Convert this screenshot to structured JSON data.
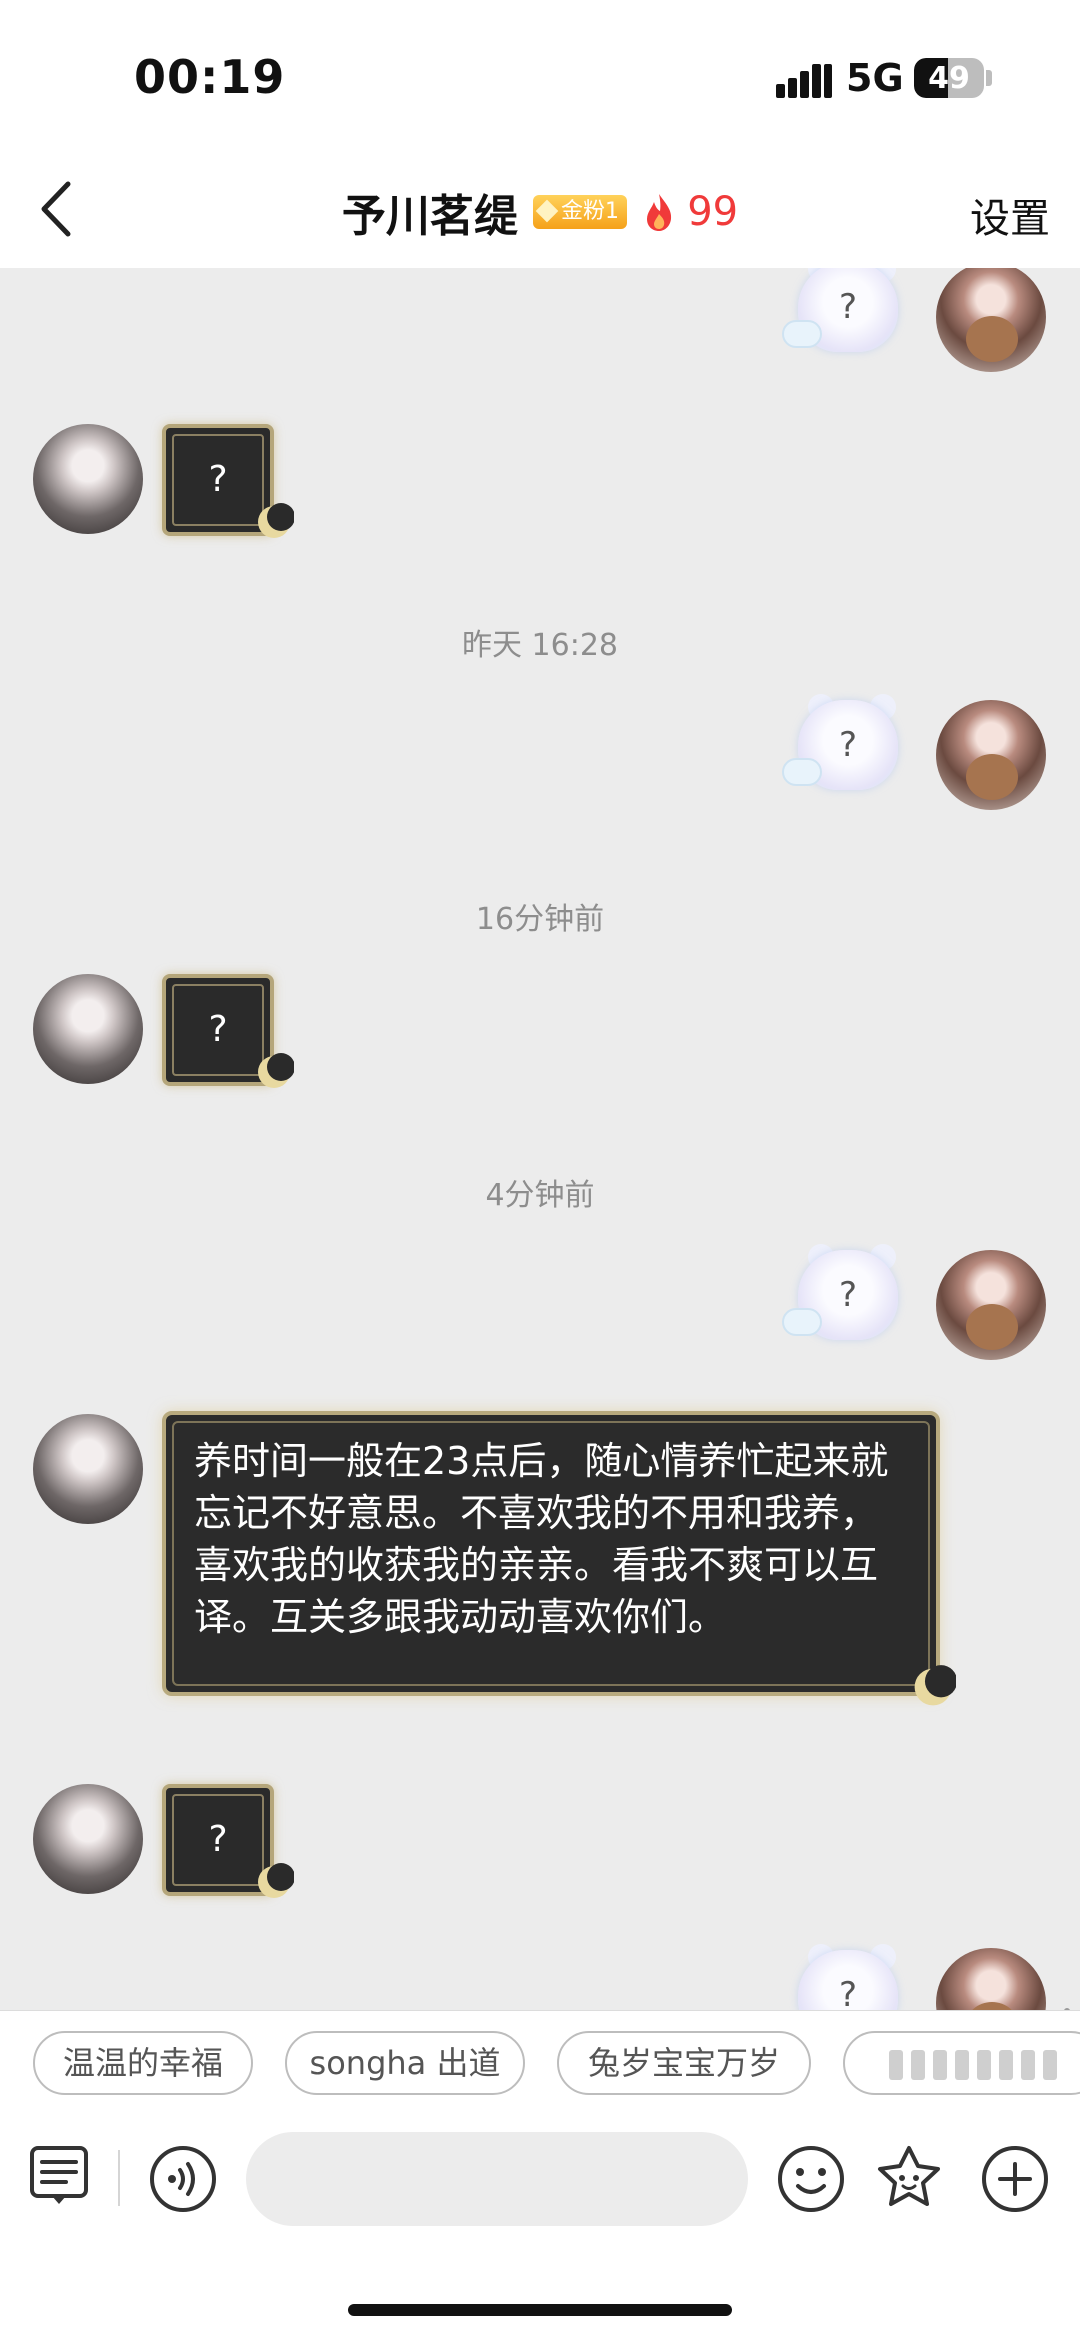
{
  "status_bar": {
    "time": "00:19",
    "network": "5G",
    "battery_level": "49",
    "battery_fraction": 0.49
  },
  "header": {
    "title": "予川茗缇",
    "badge": "金粉1",
    "fire_score": "99",
    "settings_label": "设置",
    "back_icon": "chevron-left-icon"
  },
  "chat": {
    "timestamps": [
      "昨天 16:28",
      "16分钟前",
      "4分钟前"
    ],
    "sticker_placeholder": "?",
    "message_text": "养时间一般在23点后，随心情养忙起来就忘记不好意思。不喜欢我的不用和我养，喜欢我的收获我的亲亲。看我不爽可以互译。互关多跟我动动喜欢你们。"
  },
  "quick_replies": [
    {
      "label": "温温的幸福"
    },
    {
      "label": "songha 出道"
    },
    {
      "label": "兔岁宝宝万岁"
    }
  ],
  "input_bar": {
    "placeholder": "",
    "icons": [
      "menu-list-icon",
      "voice-icon",
      "emoji-icon",
      "sticker-icon",
      "plus-icon"
    ]
  },
  "colors": {
    "fire_red": "#f03a3a",
    "badge_gold": "#f5a11a",
    "chat_bg": "#ececec",
    "bubble_dark": "#2b2b2b"
  }
}
